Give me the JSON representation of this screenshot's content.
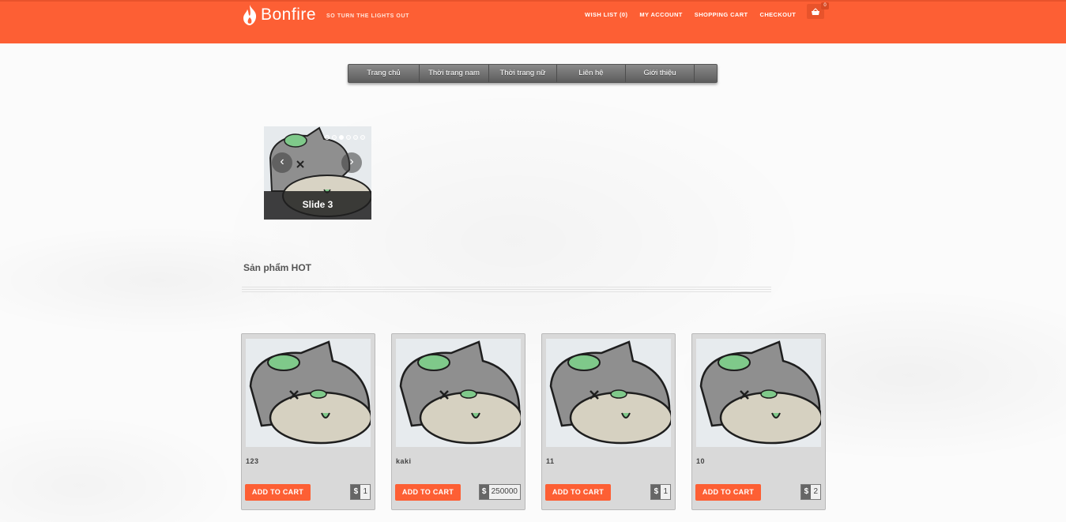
{
  "header": {
    "logo_text": "Bonfire",
    "tagline": "SO TURN THE LIGHTS OUT",
    "links": [
      "WISH LIST (0)",
      "MY ACCOUNT",
      "SHOPPING CART",
      "CHECKOUT"
    ],
    "cart_count": "0",
    "accent_color": "#fd5f34"
  },
  "nav": {
    "items": [
      "Trang chủ",
      "Thời trang nam",
      "Thời trang nữ",
      "Liên hệ",
      "Giới thiệu"
    ]
  },
  "slider": {
    "caption": "Slide 3",
    "prev_icon": "‹",
    "next_icon": "›"
  },
  "section": {
    "title": "Sản phẩm HOT"
  },
  "products": [
    {
      "name": "123",
      "button": "ADD TO CART",
      "currency": "$",
      "price": "1"
    },
    {
      "name": "kaki",
      "button": "ADD TO CART",
      "currency": "$",
      "price": "250000"
    },
    {
      "name": "11",
      "button": "ADD TO CART",
      "currency": "$",
      "price": "1"
    },
    {
      "name": "10",
      "button": "ADD TO CART",
      "currency": "$",
      "price": "2"
    }
  ]
}
